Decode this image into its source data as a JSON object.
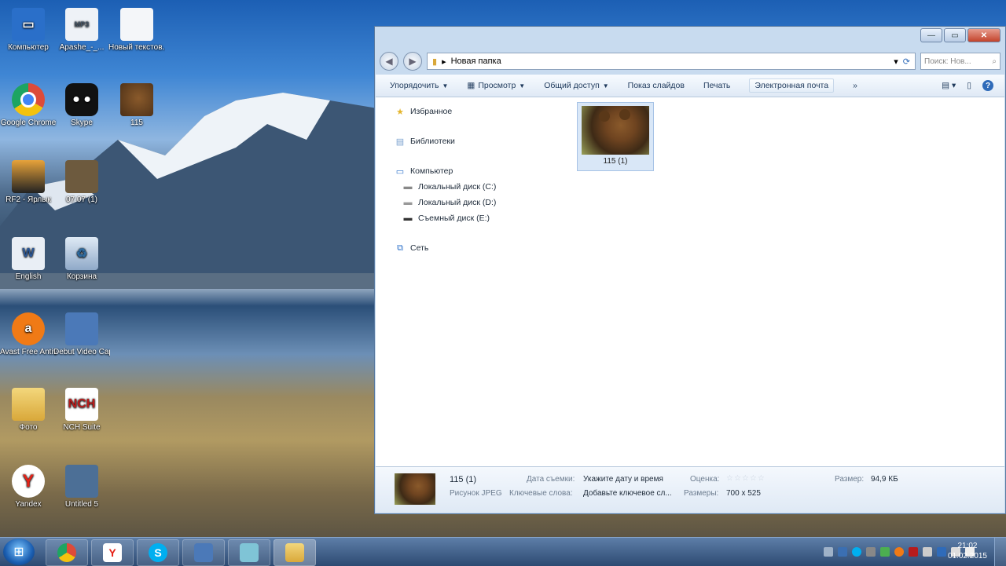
{
  "desktop": {
    "icons": [
      {
        "label": "Компьютер",
        "icon": "computer-icon",
        "color": "#2a6fc9"
      },
      {
        "label": "Apashe_-_...",
        "icon": "mp3-file-icon",
        "color": "#eef2f7"
      },
      {
        "label": "Новый текстов...",
        "icon": "text-file-icon",
        "color": "#f4f6f9"
      },
      {
        "label": "Google Chrome",
        "icon": "chrome-icon",
        "color": "#dd4b39"
      },
      {
        "label": "Skype",
        "icon": "panda-app-icon",
        "color": "#111111"
      },
      {
        "label": "115",
        "icon": "bear-image-icon",
        "color": "#7a4a22"
      },
      {
        "label": "RF2 - Ярлык",
        "icon": "game-shortcut-icon",
        "color": "#3a3a3a"
      },
      {
        "label": "07.07 (1)",
        "icon": "photo-shortcut-icon",
        "color": "#6d5a3e"
      },
      {
        "label": "English",
        "icon": "word-doc-icon",
        "color": "#e9eef5"
      },
      {
        "label": "Корзина",
        "icon": "recycle-bin-icon",
        "color": "#9fb8d6"
      },
      {
        "label": "Avast Free Antivirus",
        "icon": "avast-icon",
        "color": "#f07a16"
      },
      {
        "label": "Debut Video Capture S...",
        "icon": "debut-video-icon",
        "color": "#4b79b8"
      },
      {
        "label": "Фото",
        "icon": "folder-icon",
        "color": "#e8c25a"
      },
      {
        "label": "NCH Suite",
        "icon": "nch-icon",
        "color": "#b71c1c"
      },
      {
        "label": "Yandex",
        "icon": "yandex-icon",
        "color": "#e62117"
      },
      {
        "label": "Untitled 5",
        "icon": "video-file-icon",
        "color": "#4c6f96"
      }
    ]
  },
  "explorer": {
    "address": "Новая папка",
    "search_placeholder": "Поиск: Нов...",
    "toolbar": {
      "organize": "Упорядочить",
      "preview": "Просмотр",
      "share": "Общий доступ",
      "slideshow": "Показ слайдов",
      "print": "Печать",
      "email": "Электронная почта",
      "more": "»",
      "help": "?"
    },
    "nav": {
      "favorites": "Избранное",
      "libraries": "Библиотеки",
      "computer": "Компьютер",
      "drive_c": "Локальный диск (C:)",
      "drive_d": "Локальный диск (D:)",
      "drive_e": "Съемный диск (E:)",
      "network": "Сеть"
    },
    "files": [
      {
        "name": "115 (1)"
      }
    ],
    "details": {
      "name": "115 (1)",
      "type": "Рисунок JPEG",
      "date_label": "Дата съемки:",
      "date_value": "Укажите дату и время",
      "keywords_label": "Ключевые слова:",
      "keywords_value": "Добавьте ключевое сл...",
      "rating_label": "Оценка:",
      "rating_stars": "☆☆☆☆☆",
      "size_label": "Размер:",
      "size_value": "94,9 КБ",
      "dims_label": "Размеры:",
      "dims_value": "700 x 525"
    }
  },
  "taskbar": {
    "apps": [
      "chrome-icon",
      "yandex-icon",
      "skype-icon",
      "debut-video-icon",
      "notepad-icon",
      "explorer-folder-icon"
    ],
    "time": "21:02",
    "date": "01.02.2015"
  }
}
